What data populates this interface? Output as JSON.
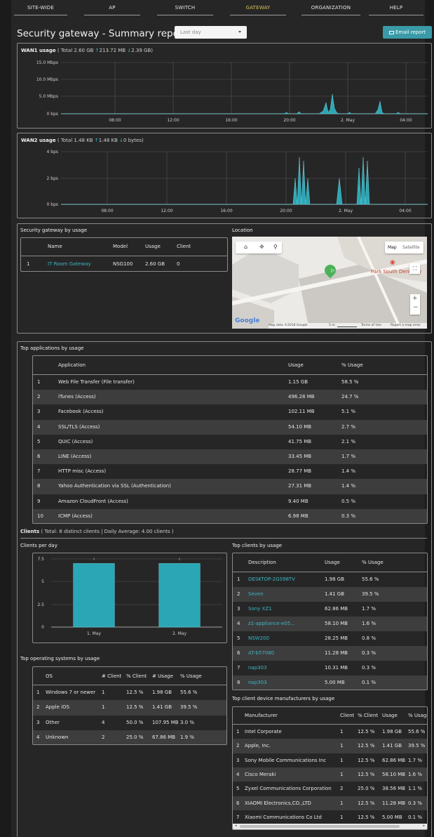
{
  "nav": [
    {
      "label": "SITE-WIDE",
      "active": false
    },
    {
      "label": "AP",
      "active": false
    },
    {
      "label": "SWITCH",
      "active": false
    },
    {
      "label": "GATEWAY",
      "active": true
    },
    {
      "label": "ORGANIZATION",
      "active": false
    },
    {
      "label": "HELP",
      "active": false
    }
  ],
  "header": {
    "title": "Security gateway - Summary report",
    "period": "Last day",
    "email_button": "Email report"
  },
  "wan1": {
    "label": "WAN1 usage",
    "total": "( Total 2.60 GB",
    "up": "213.72 MB",
    "down": "2.39 GB)",
    "y_ticks": [
      "15.0 Mbps",
      "10.0 Mbps",
      "5.0 Mbps",
      "0 bps"
    ],
    "x_ticks": [
      "08:00",
      "12:00",
      "16:00",
      "20:00",
      "2. May",
      "04:00"
    ]
  },
  "wan2": {
    "label": "WAN2 usage",
    "total": "( Total 1.48 KB",
    "up": "1.48 KB",
    "down": "0 bytes)",
    "y_ticks": [
      "4 bps",
      "2 bps",
      "0 bps"
    ],
    "x_ticks": [
      "08:00",
      "12:00",
      "16:00",
      "20:00",
      "2. May",
      "04:00"
    ]
  },
  "gateway_usage": {
    "title": "Security gateway by usage",
    "columns": [
      "Name",
      "Model",
      "Usage",
      "Client"
    ],
    "rows": [
      {
        "idx": "1",
        "name": "IT Room Gateway",
        "model": "NSG100",
        "usage": "2.60 GB",
        "client": "0"
      }
    ]
  },
  "location": {
    "title": "Location",
    "map_btn": "Map",
    "satellite_btn": "Satellite",
    "place": "Park South Dentistry",
    "google": "Google",
    "map_data": "Map data ©2018 Google",
    "scale": "5 m",
    "terms": "Terms of Use",
    "report": "Report a map error"
  },
  "top_apps": {
    "title": "Top applications by usage",
    "columns": [
      "Application",
      "Usage",
      "% Usage"
    ],
    "rows": [
      {
        "idx": "1",
        "app": "Web File Transfer (File transfer)",
        "usage": "1.15 GB",
        "pct": "58.5 %"
      },
      {
        "idx": "2",
        "app": "iTunes (Access)",
        "usage": "496.28 MB",
        "pct": "24.7 %"
      },
      {
        "idx": "3",
        "app": "Facebook (Access)",
        "usage": "102.11 MB",
        "pct": "5.1 %"
      },
      {
        "idx": "4",
        "app": "SSL/TLS (Access)",
        "usage": "54.10 MB",
        "pct": "2.7 %"
      },
      {
        "idx": "5",
        "app": "QUIC (Access)",
        "usage": "41.75 MB",
        "pct": "2.1 %"
      },
      {
        "idx": "6",
        "app": "LINE (Access)",
        "usage": "33.45 MB",
        "pct": "1.7 %"
      },
      {
        "idx": "7",
        "app": "HTTP misc (Access)",
        "usage": "28.77 MB",
        "pct": "1.4 %"
      },
      {
        "idx": "8",
        "app": "Yahoo Authentication via SSL (Authentication)",
        "usage": "27.31 MB",
        "pct": "1.4 %"
      },
      {
        "idx": "9",
        "app": "Amazon CloudFront (Access)",
        "usage": "9.40 MB",
        "pct": "0.5 %"
      },
      {
        "idx": "10",
        "app": "ICMP (Access)",
        "usage": "6.98 MB",
        "pct": "0.3 %"
      }
    ]
  },
  "clients": {
    "label": "Clients",
    "summary": "( Total: 8 distinct clients | Daily Average: 4.00 clients )"
  },
  "clients_per_day": {
    "title": "Clients per day",
    "y_ticks": [
      "7.5",
      "5",
      "2.5",
      "0"
    ]
  },
  "chart_data": {
    "type": "bar",
    "categories": [
      "1. May",
      "2. May"
    ],
    "values": [
      7,
      7
    ],
    "ylim": [
      0,
      7.5
    ],
    "title": "Clients per day",
    "xlabel": "",
    "ylabel": ""
  },
  "top_clients": {
    "title": "Top clients by usage",
    "columns": [
      "Description",
      "Usage",
      "% Usage"
    ],
    "rows": [
      {
        "idx": "1",
        "desc": "DESKTOP-2GS98TV",
        "usage": "1.98 GB",
        "pct": "55.6 %"
      },
      {
        "idx": "2",
        "desc": "Seven",
        "usage": "1.41 GB",
        "pct": "39.5 %"
      },
      {
        "idx": "3",
        "desc": "Sony XZ1",
        "usage": "62.86 MB",
        "pct": "1.7 %"
      },
      {
        "idx": "4",
        "desc": "z1-appliance-e05...",
        "usage": "58.10 MB",
        "pct": "1.6 %"
      },
      {
        "idx": "5",
        "desc": "NSW200",
        "usage": "28.25 MB",
        "pct": "0.8 %"
      },
      {
        "idx": "6",
        "desc": "AT-b57080",
        "usage": "11.28 MB",
        "pct": "0.3 %"
      },
      {
        "idx": "7",
        "desc": "nap303",
        "usage": "10.31 MB",
        "pct": "0.3 %"
      },
      {
        "idx": "8",
        "desc": "nap303",
        "usage": "5.00 MB",
        "pct": "0.1 %"
      }
    ]
  },
  "top_os": {
    "title": "Top operating systems by usage",
    "columns": [
      "OS",
      "# Client",
      "% Client",
      "# Usage",
      "% Usage"
    ],
    "rows": [
      {
        "idx": "1",
        "os": "Windows 7 or newer",
        "client": "1",
        "pclient": "12.5 %",
        "usage": "1.98 GB",
        "pusage": "55.6 %"
      },
      {
        "idx": "2",
        "os": "Apple iOS",
        "client": "1",
        "pclient": "12.5 %",
        "usage": "1.41 GB",
        "pusage": "39.5 %"
      },
      {
        "idx": "3",
        "os": "Other",
        "client": "4",
        "pclient": "50.0 %",
        "usage": "107.95 MB",
        "pusage": "3.0 %"
      },
      {
        "idx": "4",
        "os": "Unknown",
        "client": "2",
        "pclient": "25.0 %",
        "usage": "67.86 MB",
        "pusage": "1.9 %"
      }
    ]
  },
  "top_manufacturers": {
    "title": "Top client device manufacturers by usage",
    "columns": [
      "Manufacturer",
      "Client",
      "% Client",
      "Usage",
      "% Usage"
    ],
    "rows": [
      {
        "idx": "1",
        "name": "Intel Corporate",
        "client": "1",
        "pclient": "12.5 %",
        "usage": "1.98 GB",
        "pusage": "55.6 %"
      },
      {
        "idx": "2",
        "name": "Apple, Inc.",
        "client": "1",
        "pclient": "12.5 %",
        "usage": "1.41 GB",
        "pusage": "39.5 %"
      },
      {
        "idx": "3",
        "name": "Sony Mobile Communications Inc",
        "client": "1",
        "pclient": "12.5 %",
        "usage": "62.86 MB",
        "pusage": "1.7 %"
      },
      {
        "idx": "4",
        "name": "Cisco Meraki",
        "client": "1",
        "pclient": "12.5 %",
        "usage": "58.10 MB",
        "pusage": "1.6 %"
      },
      {
        "idx": "5",
        "name": "Zyxel Communications Corporation",
        "client": "2",
        "pclient": "25.0 %",
        "usage": "38.56 MB",
        "pusage": "1.1 %"
      },
      {
        "idx": "6",
        "name": "XIAOMI Electronics,CO.,LTD",
        "client": "1",
        "pclient": "12.5 %",
        "usage": "11.28 MB",
        "pusage": "0.3 %"
      },
      {
        "idx": "7",
        "name": "Xiaomi Communications Co Ltd",
        "client": "1",
        "pclient": "12.5 %",
        "usage": "5.00 MB",
        "pusage": "0.1 %"
      }
    ]
  },
  "colors": {
    "accent": "#3a9aa8",
    "link": "#3fb5c4",
    "active_nav": "#d7c25a",
    "bar": "#2ba6b5"
  }
}
